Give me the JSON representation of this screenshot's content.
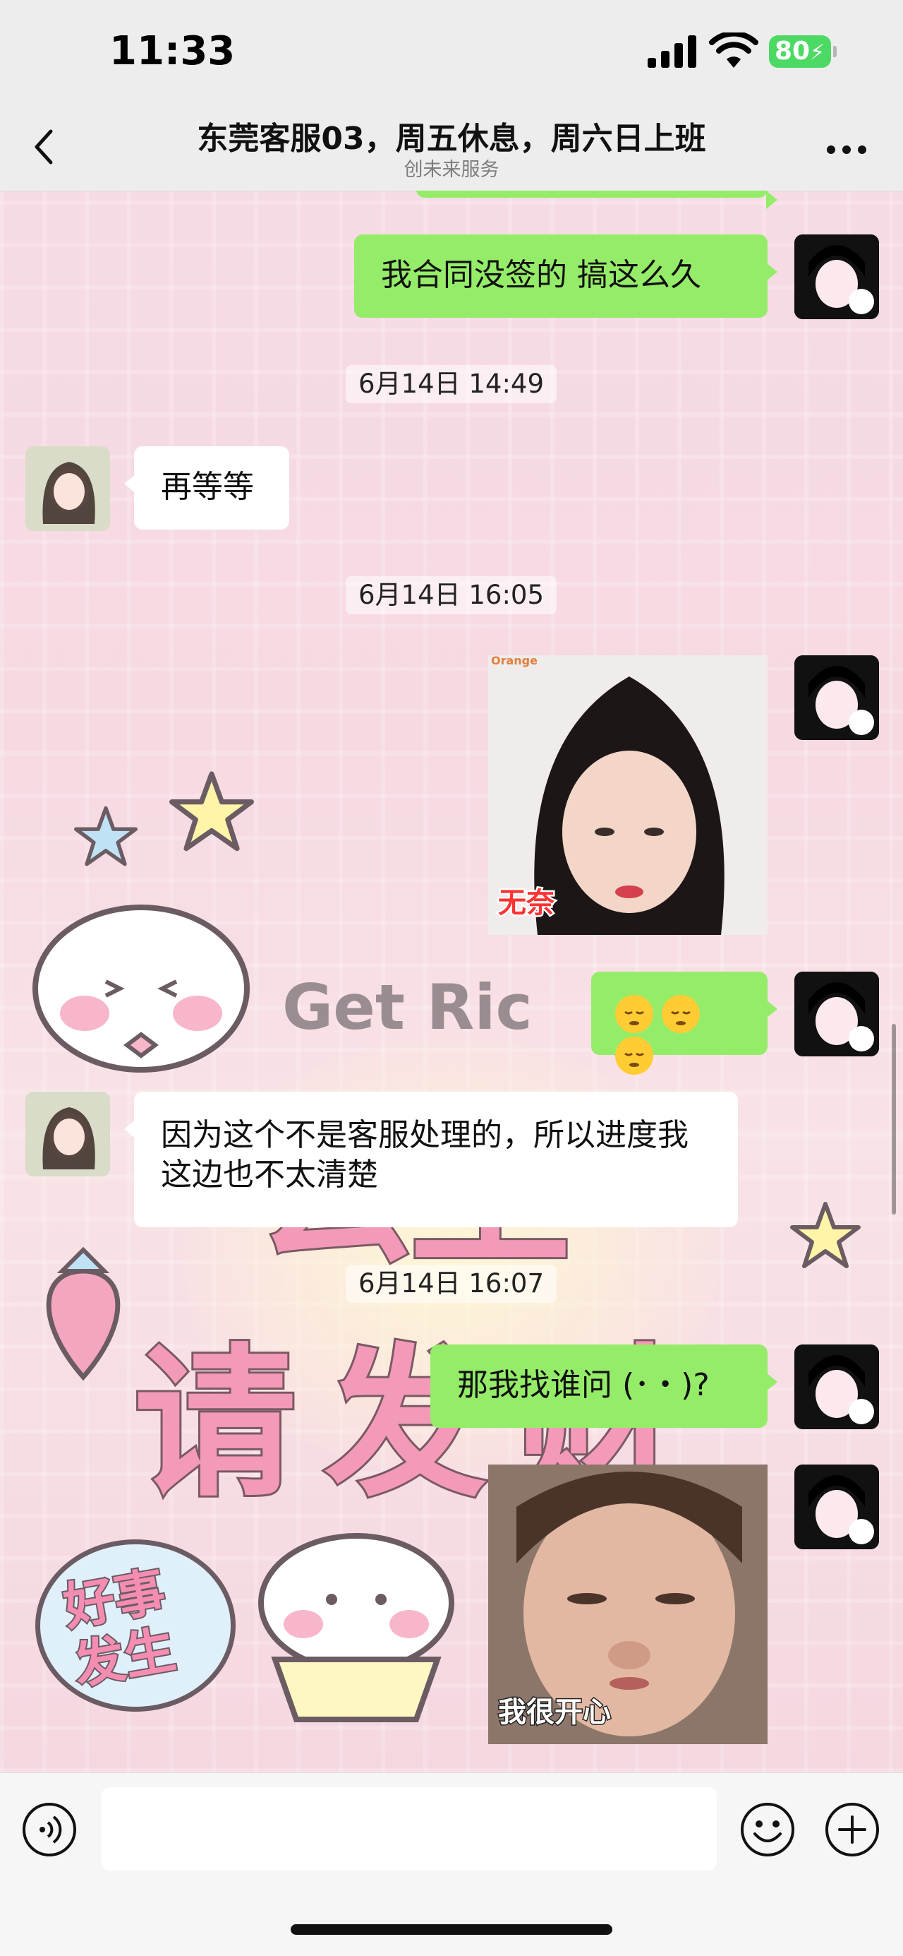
{
  "status_bar": {
    "time": "11:33",
    "battery": "80"
  },
  "nav": {
    "title": "东莞客服03，周五休息，周六日上班",
    "subtitle": "创未来服务",
    "back_icon": "chevron-left-icon",
    "more_icon": "more-dots-icon"
  },
  "wallpaper": {
    "text_get_rich": "Get Ric",
    "text_gongzhu": "公主",
    "text_qingfa": "请发财",
    "sticker": "好事发生"
  },
  "messages": [
    {
      "type": "text",
      "sender": "me",
      "text": "我合同没签的  搞这么久"
    },
    {
      "type": "timestamp",
      "text": "6月14日 14:49"
    },
    {
      "type": "text",
      "sender": "other",
      "text": "再等等"
    },
    {
      "type": "timestamp",
      "text": "6月14日 16:05"
    },
    {
      "type": "image",
      "sender": "me",
      "watermark": "Orange",
      "caption": "无奈"
    },
    {
      "type": "emoji",
      "sender": "me",
      "emoji_name": "pensive-face-emoji",
      "count": 3
    },
    {
      "type": "text",
      "sender": "other",
      "text": "因为这个不是客服处理的，所以进度我这边也不太清楚"
    },
    {
      "type": "timestamp",
      "text": "6月14日 16:07"
    },
    {
      "type": "text",
      "sender": "me",
      "text": "那我找谁问 (･・)?"
    },
    {
      "type": "image",
      "sender": "me",
      "caption": "我很开心"
    }
  ],
  "input_bar": {
    "voice_icon": "voice-icon",
    "emoji_icon": "emoji-icon",
    "plus_icon": "plus-icon",
    "placeholder": ""
  },
  "colors": {
    "my_bubble": "#95ec69",
    "other_bubble": "#ffffff",
    "bar_bg": "#ededed",
    "battery": "#4cd964"
  }
}
